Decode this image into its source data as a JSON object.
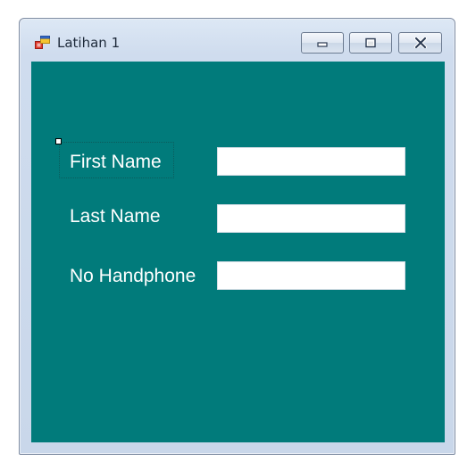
{
  "window": {
    "title": "Latihan 1",
    "icon": "form-window-icon",
    "controls": {
      "minimize": "minimize-icon",
      "maximize": "maximize-icon",
      "close": "close-icon"
    }
  },
  "form": {
    "background_color": "#017b7b",
    "fields": [
      {
        "label": "First Name",
        "value": ""
      },
      {
        "label": "Last Name",
        "value": ""
      },
      {
        "label": "No Handphone",
        "value": ""
      }
    ]
  }
}
